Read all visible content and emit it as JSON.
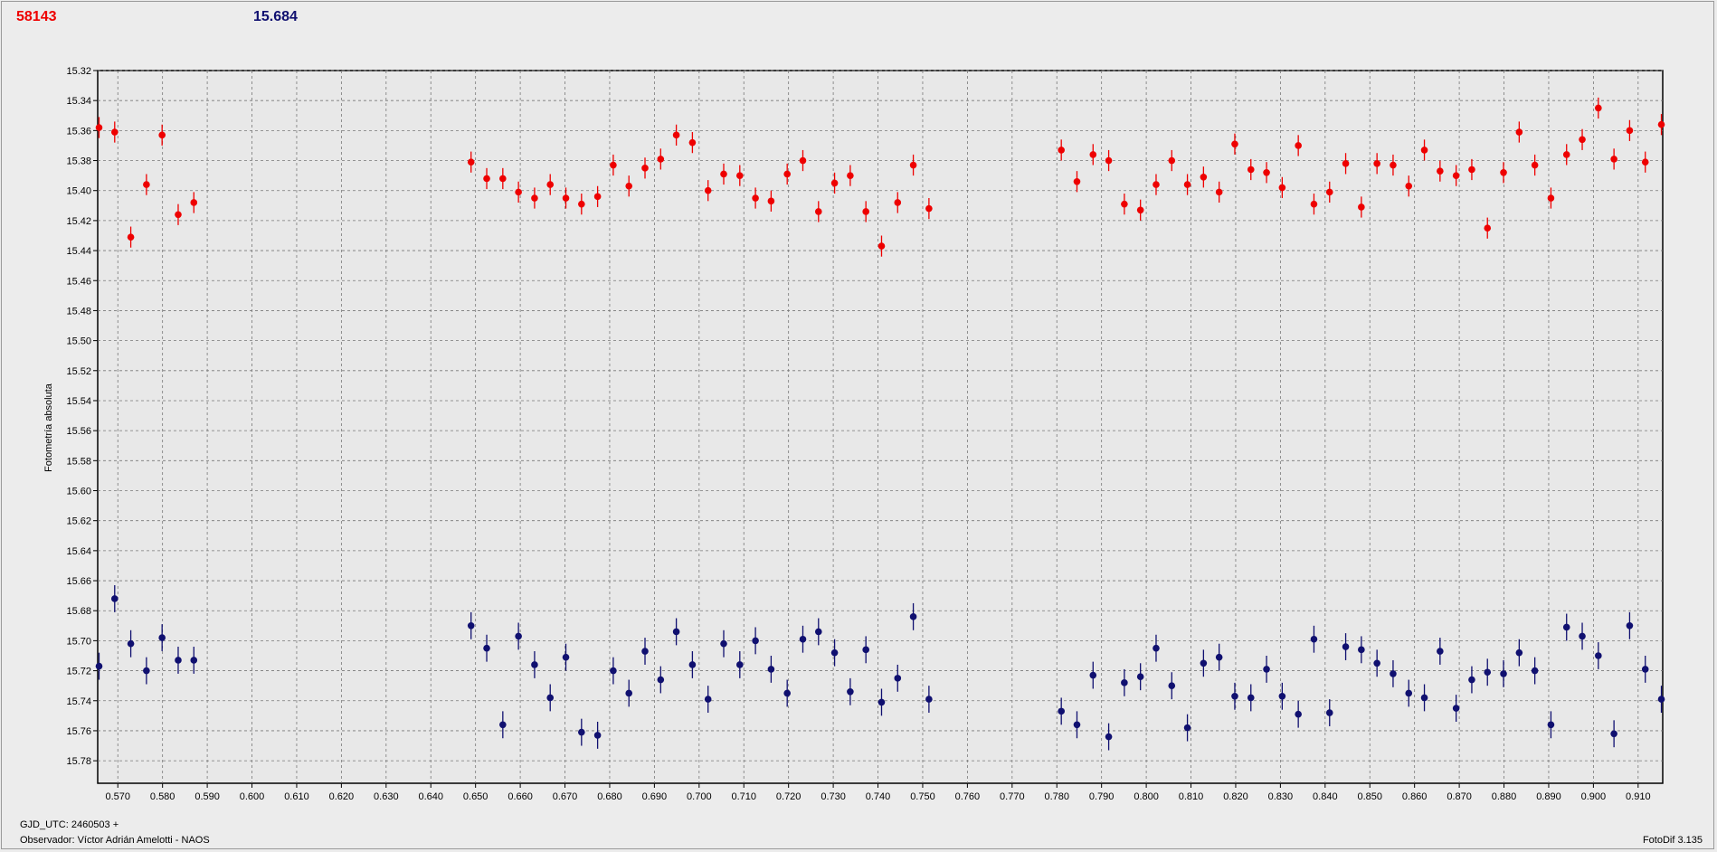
{
  "header": {
    "red_value": "58143",
    "blue_value": "15.684"
  },
  "footer": {
    "gjd": "GJD_UTC: 2460503 +",
    "observer": "Observador: Víctor Adrián Amelotti - NAOS",
    "version": "FotoDif 3.135"
  },
  "chart_data": {
    "type": "scatter",
    "ylabel": "Fotometría absoluta",
    "xlabel": "",
    "xlim": [
      0.5655,
      0.9155
    ],
    "ylim": [
      15.32,
      15.795
    ],
    "y_inverted": true,
    "grid": true,
    "x_ticks": [
      "0.570",
      "0.580",
      "0.590",
      "0.600",
      "0.610",
      "0.620",
      "0.630",
      "0.640",
      "0.650",
      "0.660",
      "0.670",
      "0.680",
      "0.690",
      "0.700",
      "0.710",
      "0.720",
      "0.730",
      "0.740",
      "0.750",
      "0.760",
      "0.770",
      "0.780",
      "0.790",
      "0.800",
      "0.810",
      "0.820",
      "0.830",
      "0.840",
      "0.850",
      "0.860",
      "0.870",
      "0.880",
      "0.890",
      "0.900",
      "0.910"
    ],
    "y_ticks": [
      "15.32",
      "15.34",
      "15.36",
      "15.38",
      "15.40",
      "15.42",
      "15.44",
      "15.46",
      "15.48",
      "15.50",
      "15.52",
      "15.54",
      "15.56",
      "15.58",
      "15.60",
      "15.62",
      "15.64",
      "15.66",
      "15.68",
      "15.70",
      "15.72",
      "15.74",
      "15.76",
      "15.78"
    ],
    "series": [
      {
        "color": "#ee0000",
        "error": 0.007,
        "x": [
          0.5658,
          0.5693,
          0.5729,
          0.5764,
          0.5799,
          0.5835,
          0.587,
          0.649,
          0.6525,
          0.6561,
          0.6596,
          0.6632,
          0.6667,
          0.6702,
          0.6737,
          0.6773,
          0.6808,
          0.6843,
          0.6879,
          0.6914,
          0.6949,
          0.6985,
          0.702,
          0.7055,
          0.7091,
          0.7126,
          0.7161,
          0.7197,
          0.7232,
          0.7267,
          0.7303,
          0.7338,
          0.7373,
          0.7408,
          0.7444,
          0.7479,
          0.7514,
          0.781,
          0.7845,
          0.7881,
          0.7916,
          0.7951,
          0.7987,
          0.8022,
          0.8057,
          0.8092,
          0.8128,
          0.8163,
          0.8198,
          0.8234,
          0.8269,
          0.8304,
          0.834,
          0.8375,
          0.841,
          0.8446,
          0.8481,
          0.8516,
          0.8552,
          0.8587,
          0.8622,
          0.8657,
          0.8693,
          0.8728,
          0.8763,
          0.8799,
          0.8834,
          0.8869,
          0.8905,
          0.894,
          0.8975,
          0.9011,
          0.9046,
          0.9081,
          0.9116,
          0.9152
        ],
        "y": [
          15.358,
          15.361,
          15.431,
          15.396,
          15.363,
          15.416,
          15.408,
          15.381,
          15.392,
          15.392,
          15.401,
          15.405,
          15.396,
          15.405,
          15.409,
          15.404,
          15.383,
          15.397,
          15.385,
          15.379,
          15.363,
          15.368,
          15.4,
          15.389,
          15.39,
          15.405,
          15.407,
          15.389,
          15.38,
          15.414,
          15.395,
          15.39,
          15.414,
          15.437,
          15.408,
          15.383,
          15.412,
          15.373,
          15.394,
          15.376,
          15.38,
          15.409,
          15.413,
          15.396,
          15.38,
          15.396,
          15.391,
          15.401,
          15.369,
          15.386,
          15.388,
          15.398,
          15.37,
          15.409,
          15.401,
          15.382,
          15.411,
          15.382,
          15.383,
          15.397,
          15.373,
          15.387,
          15.39,
          15.386,
          15.425,
          15.388,
          15.361,
          15.383,
          15.405,
          15.376,
          15.366,
          15.345,
          15.379,
          15.36,
          15.381,
          15.356
        ]
      },
      {
        "color": "#101070",
        "error": 0.009,
        "x": [
          0.5658,
          0.5693,
          0.5729,
          0.5764,
          0.5799,
          0.5835,
          0.587,
          0.649,
          0.6525,
          0.6561,
          0.6596,
          0.6632,
          0.6667,
          0.6702,
          0.6737,
          0.6773,
          0.6808,
          0.6843,
          0.6879,
          0.6914,
          0.6949,
          0.6985,
          0.702,
          0.7055,
          0.7091,
          0.7126,
          0.7161,
          0.7197,
          0.7232,
          0.7267,
          0.7303,
          0.7338,
          0.7373,
          0.7408,
          0.7444,
          0.7479,
          0.7514,
          0.781,
          0.7845,
          0.7881,
          0.7916,
          0.7951,
          0.7987,
          0.8022,
          0.8057,
          0.8092,
          0.8128,
          0.8163,
          0.8198,
          0.8234,
          0.8269,
          0.8304,
          0.834,
          0.8375,
          0.841,
          0.8446,
          0.8481,
          0.8516,
          0.8552,
          0.8587,
          0.8622,
          0.8657,
          0.8693,
          0.8728,
          0.8763,
          0.8799,
          0.8834,
          0.8869,
          0.8905,
          0.894,
          0.8975,
          0.9011,
          0.9046,
          0.9081,
          0.9116,
          0.9152
        ],
        "y": [
          15.717,
          15.672,
          15.702,
          15.72,
          15.698,
          15.713,
          15.713,
          15.69,
          15.705,
          15.756,
          15.697,
          15.716,
          15.738,
          15.711,
          15.761,
          15.763,
          15.72,
          15.735,
          15.707,
          15.726,
          15.694,
          15.716,
          15.739,
          15.702,
          15.716,
          15.7,
          15.719,
          15.735,
          15.699,
          15.694,
          15.708,
          15.734,
          15.706,
          15.741,
          15.725,
          15.684,
          15.739,
          15.747,
          15.756,
          15.723,
          15.764,
          15.728,
          15.724,
          15.705,
          15.73,
          15.758,
          15.715,
          15.711,
          15.737,
          15.738,
          15.719,
          15.737,
          15.749,
          15.699,
          15.748,
          15.704,
          15.706,
          15.715,
          15.722,
          15.735,
          15.738,
          15.707,
          15.745,
          15.726,
          15.721,
          15.722,
          15.708,
          15.72,
          15.756,
          15.691,
          15.697,
          15.71,
          15.762,
          15.69,
          15.719,
          15.739
        ]
      }
    ]
  }
}
